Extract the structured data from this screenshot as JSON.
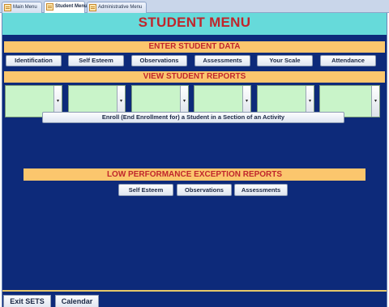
{
  "tabs": [
    {
      "label": "Main Menu",
      "active": false
    },
    {
      "label": "Student Menu",
      "active": true
    },
    {
      "label": "Administrative Menu",
      "active": false
    }
  ],
  "title": "STUDENT MENU",
  "enter_data": {
    "heading": "ENTER STUDENT DATA",
    "buttons": [
      "Identification",
      "Self Esteem",
      "Observations",
      "Assessments",
      "Your  Scale",
      "Attendance"
    ]
  },
  "reports": {
    "heading": "VIEW STUDENT REPORTS",
    "combo_count": 6
  },
  "enroll_button": "Enroll (End Enrollment for) a Student in a Section of an Activity",
  "low_performance": {
    "heading": "LOW PERFORMANCE EXCEPTION REPORTS",
    "buttons": [
      "Self Esteem",
      "Observations",
      "Assessments"
    ]
  },
  "footer": {
    "exit_label": "Exit SETS",
    "calendar_label": "Calendar"
  },
  "colors": {
    "form_background": "#0d2a7a",
    "header_background": "#66dada",
    "band_background": "#fbc66d",
    "title_text": "#c0262c",
    "combo_background": "#c9f4c9"
  }
}
